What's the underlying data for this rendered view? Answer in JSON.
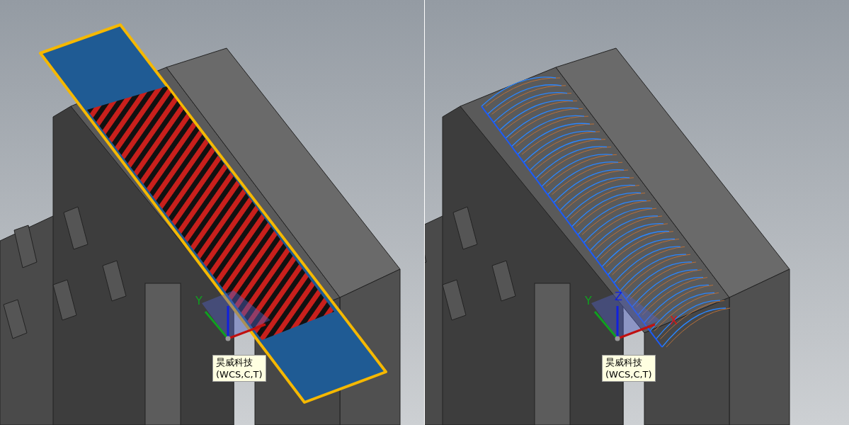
{
  "viewports": [
    {
      "kind": "hatch",
      "triad_labels": [
        {
          "kind": "y-axis",
          "color": "#10a020",
          "text": "Y"
        }
      ],
      "tag": {
        "lines": [
          "昊威科技",
          "(WCS,C,T)"
        ]
      }
    },
    {
      "kind": "toolpath",
      "triad_labels": [
        {
          "kind": "y-axis",
          "color": "#10a020",
          "text": "Y"
        },
        {
          "kind": "z-axis",
          "color": "#1020e0",
          "text": "Z"
        },
        {
          "kind": "x-axis",
          "color": "#e01010",
          "text": "X"
        }
      ],
      "tag": {
        "lines": [
          "昊威科技",
          "(WCS,C,T)"
        ]
      }
    }
  ]
}
